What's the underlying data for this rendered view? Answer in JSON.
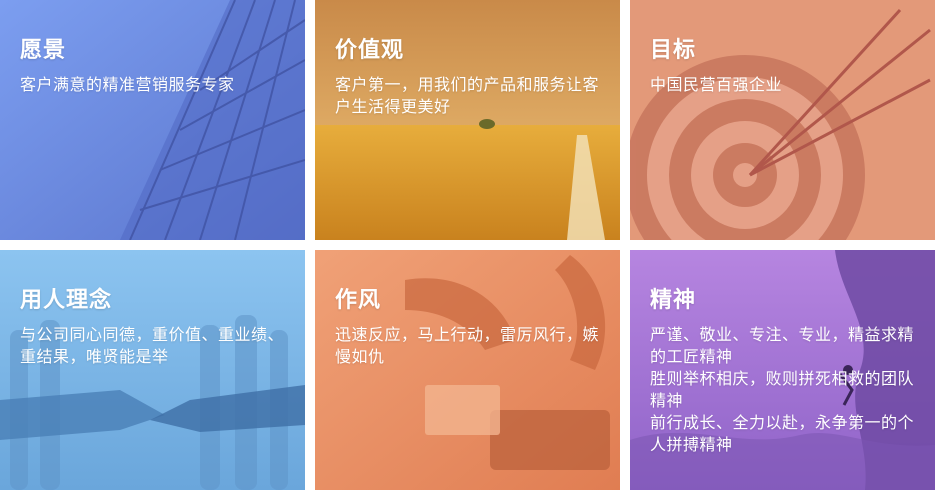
{
  "cards": [
    {
      "title": "愿景",
      "lines": [
        "客户满意的精准营销服务专家"
      ]
    },
    {
      "title": "价值观",
      "lines": [
        "客户第一，用我们的产品和服务让客户生活得更美好"
      ]
    },
    {
      "title": "目标",
      "lines": [
        "中国民营百强企业"
      ]
    },
    {
      "title": "用人理念",
      "lines": [
        "与公司同心同德，重价值、重业绩、重结果，唯贤能是举"
      ]
    },
    {
      "title": "作风",
      "lines": [
        "迅速反应，马上行动，雷厉风行，嫉慢如仇"
      ]
    },
    {
      "title": "精神",
      "lines": [
        "严谨、敬业、专注、专业，精益求精的工匠精神",
        "胜则举杯相庆，败则拼死相救的团队精神",
        "前行成长、全力以赴，永争第一的个人拼搏精神"
      ]
    }
  ],
  "colors": {
    "vision": "#6f8fe0",
    "values": "#e8a94a",
    "goal": "#e19276",
    "people": "#7fb6e6",
    "style": "#ec8f63",
    "spirit": "#b07fd8"
  },
  "icons": [
    "building-glass-image",
    "wheat-field-image",
    "target-arrows-image",
    "handshake-image",
    "desk-work-image",
    "cliff-climb-image"
  ]
}
